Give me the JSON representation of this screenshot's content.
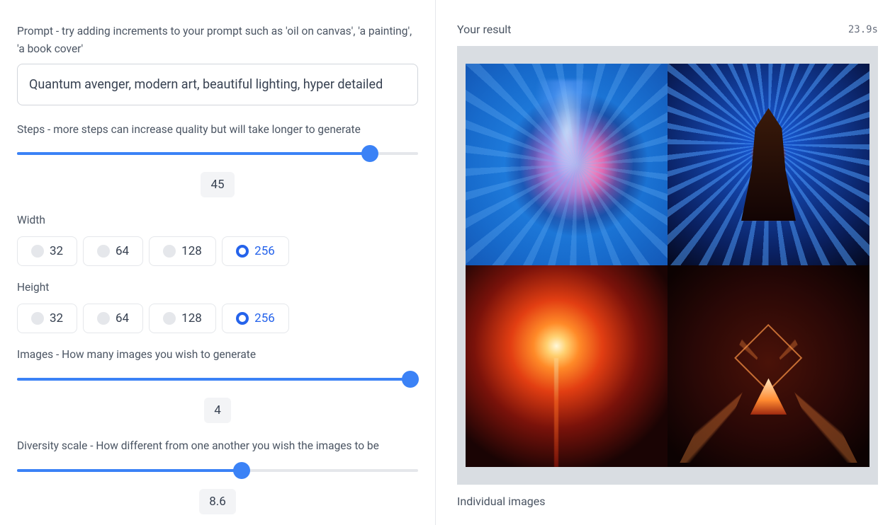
{
  "prompt": {
    "label": "Prompt - try adding increments to your prompt such as 'oil on canvas', 'a painting', 'a book cover'",
    "value": "Quantum avenger, modern art, beautiful lighting, hyper detailed"
  },
  "steps": {
    "label": "Steps - more steps can increase quality but will take longer to generate",
    "value": "45",
    "percent": 88
  },
  "width": {
    "label": "Width",
    "options": [
      "32",
      "64",
      "128",
      "256"
    ],
    "selected": "256"
  },
  "height": {
    "label": "Height",
    "options": [
      "32",
      "64",
      "128",
      "256"
    ],
    "selected": "256"
  },
  "images": {
    "label": "Images - How many images you wish to generate",
    "value": "4",
    "percent": 98
  },
  "diversity": {
    "label": "Diversity scale - How different from one another you wish the images to be",
    "value": "8.6",
    "percent": 56
  },
  "result": {
    "title": "Your result",
    "timing": "23.9s",
    "individual_label": "Individual images"
  }
}
